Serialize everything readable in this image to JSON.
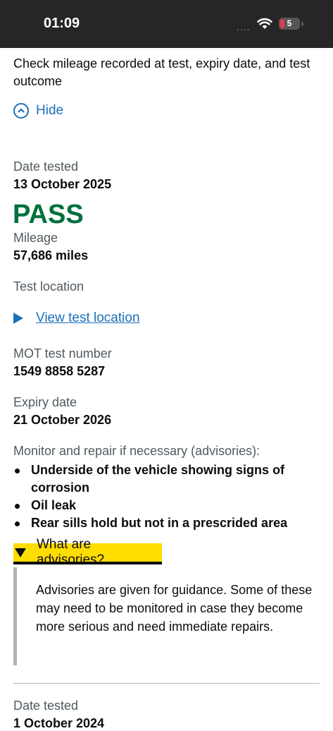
{
  "status_bar": {
    "time": "01:09",
    "battery": "5",
    "signal_dots": "...."
  },
  "intro": "Check mileage recorded at test, expiry date, and test outcome",
  "hide_label": "Hide",
  "test": {
    "date_label": "Date tested",
    "date_value": "13 October 2025",
    "result": "PASS",
    "mileage_label": "Mileage",
    "mileage_value": "57,686 miles",
    "location_label": "Test location",
    "location_link": "View test location",
    "test_number_label": "MOT test number",
    "test_number_value": "1549 8858 5287",
    "expiry_label": "Expiry date",
    "expiry_value": "21 October 2026",
    "advisories_label": "Monitor and repair if necessary (advisories):",
    "advisories": [
      "Underside of the vehicle showing signs of corrosion",
      "Oil leak",
      "Rear sills hold but not in a prescrided area"
    ],
    "what_are_advisories": "What are advisories?",
    "advisories_info": "Advisories are given for guidance. Some of these may need to be monitored in case they become more serious and need immediate repairs."
  },
  "next_test": {
    "date_label": "Date tested",
    "date_value": "1 October 2024"
  },
  "colors": {
    "pass": "#00703c",
    "link": "#1d70b8",
    "highlight": "#ffdd00"
  }
}
